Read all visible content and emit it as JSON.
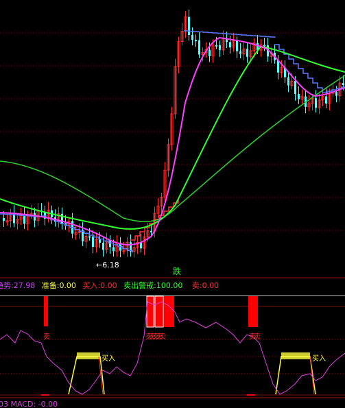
{
  "colors": {
    "background": "#000000",
    "grid": "#7a1010",
    "up": "#ff3030",
    "down": "#54ffff",
    "ma_long": "#30d030",
    "ma_mid": "#30ff30",
    "ma_short": "#ff40ff",
    "step": "#5a78ff",
    "oscillator": "#e040e0",
    "signal_yellow": "#ffff40",
    "bar_red": "#ff0000",
    "white": "#ffffff",
    "label_red": "#ff3030",
    "label_green": "#30ff30",
    "label_yellow": "#ffff40"
  },
  "price_panel": {
    "low_marker": "6.18",
    "marker_label": "跌"
  },
  "indicator_header": {
    "items": [
      {
        "label": "趋势:",
        "value": "27.98",
        "color": "#d040ff"
      },
      {
        "label": "准备:",
        "value": "0.00",
        "color": "#ffff40"
      },
      {
        "label": "买入:",
        "value": "0.00",
        "color": "#ff3030"
      },
      {
        "label": "卖出警戒:",
        "value": "100.00",
        "color": "#30ff30"
      },
      {
        "label": "卖:",
        "value": "0.00",
        "color": "#ff3030"
      }
    ]
  },
  "indicator_panel": {
    "sell_label": "卖",
    "buy_label": "买入",
    "sell_groups": [
      "卖",
      "卖卖卖卖卖",
      "卖卖"
    ],
    "buy_groups": [
      "买入",
      "买入"
    ]
  },
  "footer": {
    "text": "03 MACD: -0.00"
  },
  "chart_data": {
    "type": "candlestick",
    "series": [
      {
        "name": "K",
        "values": []
      }
    ],
    "low_price": 6.18,
    "indicator_values": {
      "趋势": 27.98,
      "准备": 0.0,
      "买入": 0.0,
      "卖出警戒": 100.0,
      "卖": 0.0,
      "MACD": -0.0
    }
  }
}
